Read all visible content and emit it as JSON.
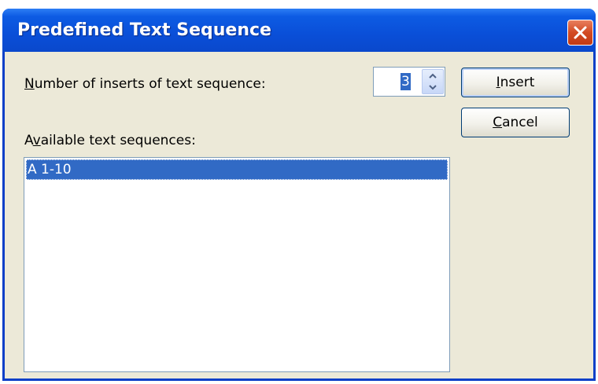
{
  "dialog": {
    "title": "Predefined Text Sequence"
  },
  "inserts": {
    "label_mnemonic": "N",
    "label_rest": "umber of inserts of text sequence:",
    "value": "3"
  },
  "sequences": {
    "label_before": "A",
    "label_mnemonic": "v",
    "label_rest": "ailable text sequences:",
    "items": [
      "A 1-10"
    ]
  },
  "buttons": {
    "insert_mnemonic": "I",
    "insert_rest": "nsert",
    "cancel_mnemonic": "C",
    "cancel_rest": "ancel"
  },
  "colors": {
    "titlebar": "#0a4fd8",
    "dialog_bg": "#ece9d8",
    "selection": "#316ac5",
    "close_button": "#d24a22"
  }
}
